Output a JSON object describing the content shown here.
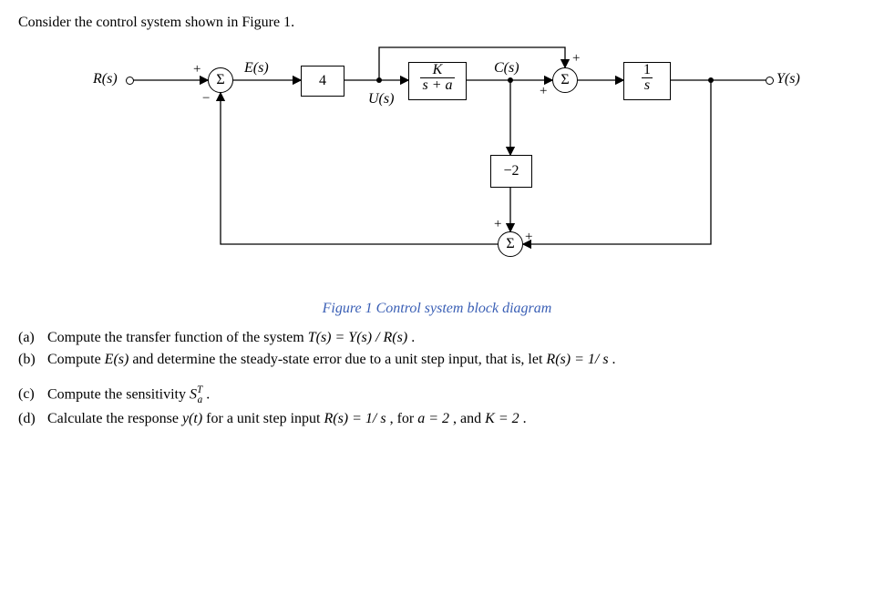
{
  "problem": {
    "intro": "Consider the control system shown in Figure 1.",
    "caption": "Figure 1 Control system block diagram",
    "items": {
      "a": {
        "label": "(a)",
        "before": "Compute the transfer function of the system ",
        "expr": "T(s) = Y(s) / R(s)",
        "after": " ."
      },
      "b": {
        "label": "(b)",
        "before": "Compute ",
        "e": "E(s)",
        "mid": " and determine the steady-state error due to a unit step input, that is, let ",
        "rs": "R(s) = 1/ s",
        "after": " ."
      },
      "c": {
        "label": "(c)",
        "before": "Compute the sensitivity ",
        "sens_base": "S",
        "sens_sup": "T",
        "sens_sub": "a",
        "after": " ."
      },
      "d": {
        "label": "(d)",
        "before": "Calculate the response ",
        "yt": "y(t)",
        "mid1": " for a unit step input ",
        "rs": "R(s) = 1/ s",
        "mid2": " , for ",
        "a": "a = 2",
        "mid3": " , and ",
        "k": "K = 2",
        "after": " ."
      }
    }
  },
  "diagram": {
    "R": "R(s)",
    "E": "E(s)",
    "U": "U(s)",
    "C": "C(s)",
    "Y": "Y(s)",
    "g1": "4",
    "g2_num": "K",
    "g2_den": "s + a",
    "g3_num": "1",
    "g3_den": "s",
    "fb": "−2",
    "sigma": "Σ",
    "plus": "+",
    "minus": "−"
  }
}
